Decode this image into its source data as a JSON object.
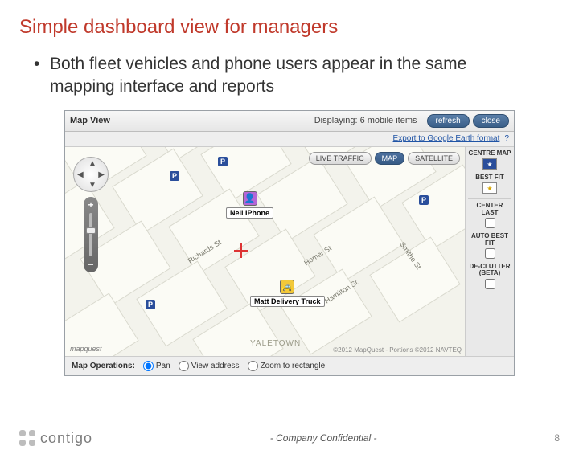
{
  "slide": {
    "title": "Simple dashboard view for managers",
    "bullet": "Both fleet vehicles and phone users appear in the same mapping interface and reports"
  },
  "map": {
    "title": "Map View",
    "displaying": "Displaying: 6 mobile items",
    "refresh": "refresh",
    "close": "close",
    "export": "Export to Google Earth format",
    "types": {
      "live": "LIVE TRAFFIC",
      "map": "MAP",
      "sat": "SATELLITE"
    },
    "markers": [
      {
        "label": "Neil IPhone",
        "icon_bg": "#b565d6",
        "glyph": "👤"
      },
      {
        "label": "Matt Delivery Truck",
        "icon_bg": "#f2c83a",
        "glyph": "🚕"
      }
    ],
    "sidebar": [
      {
        "label": "CENTRE MAP",
        "kind": "icon",
        "color": "#2a4e9b"
      },
      {
        "label": "BEST FIT",
        "kind": "icon",
        "color": "#d6a400"
      },
      {
        "label": "CENTER LAST",
        "kind": "checkbox",
        "checked": false
      },
      {
        "label": "AUTO BEST FIT",
        "kind": "checkbox",
        "checked": false
      },
      {
        "label": "DE-CLUTTER (BETA)",
        "kind": "checkbox",
        "checked": false
      }
    ],
    "streets": [
      "Richards St",
      "Homer St",
      "Hamilton St",
      "Smithe St"
    ],
    "district": "YALETOWN",
    "provider": "mapquest",
    "copyright": "©2012 MapQuest - Portions ©2012 NAVTEQ",
    "ops": {
      "title": "Map Operations:",
      "pan": "Pan",
      "view": "View address",
      "zoom": "Zoom to rectangle"
    }
  },
  "footer": {
    "brand": "contigo",
    "confidential": "- Company Confidential -",
    "page": "8"
  }
}
